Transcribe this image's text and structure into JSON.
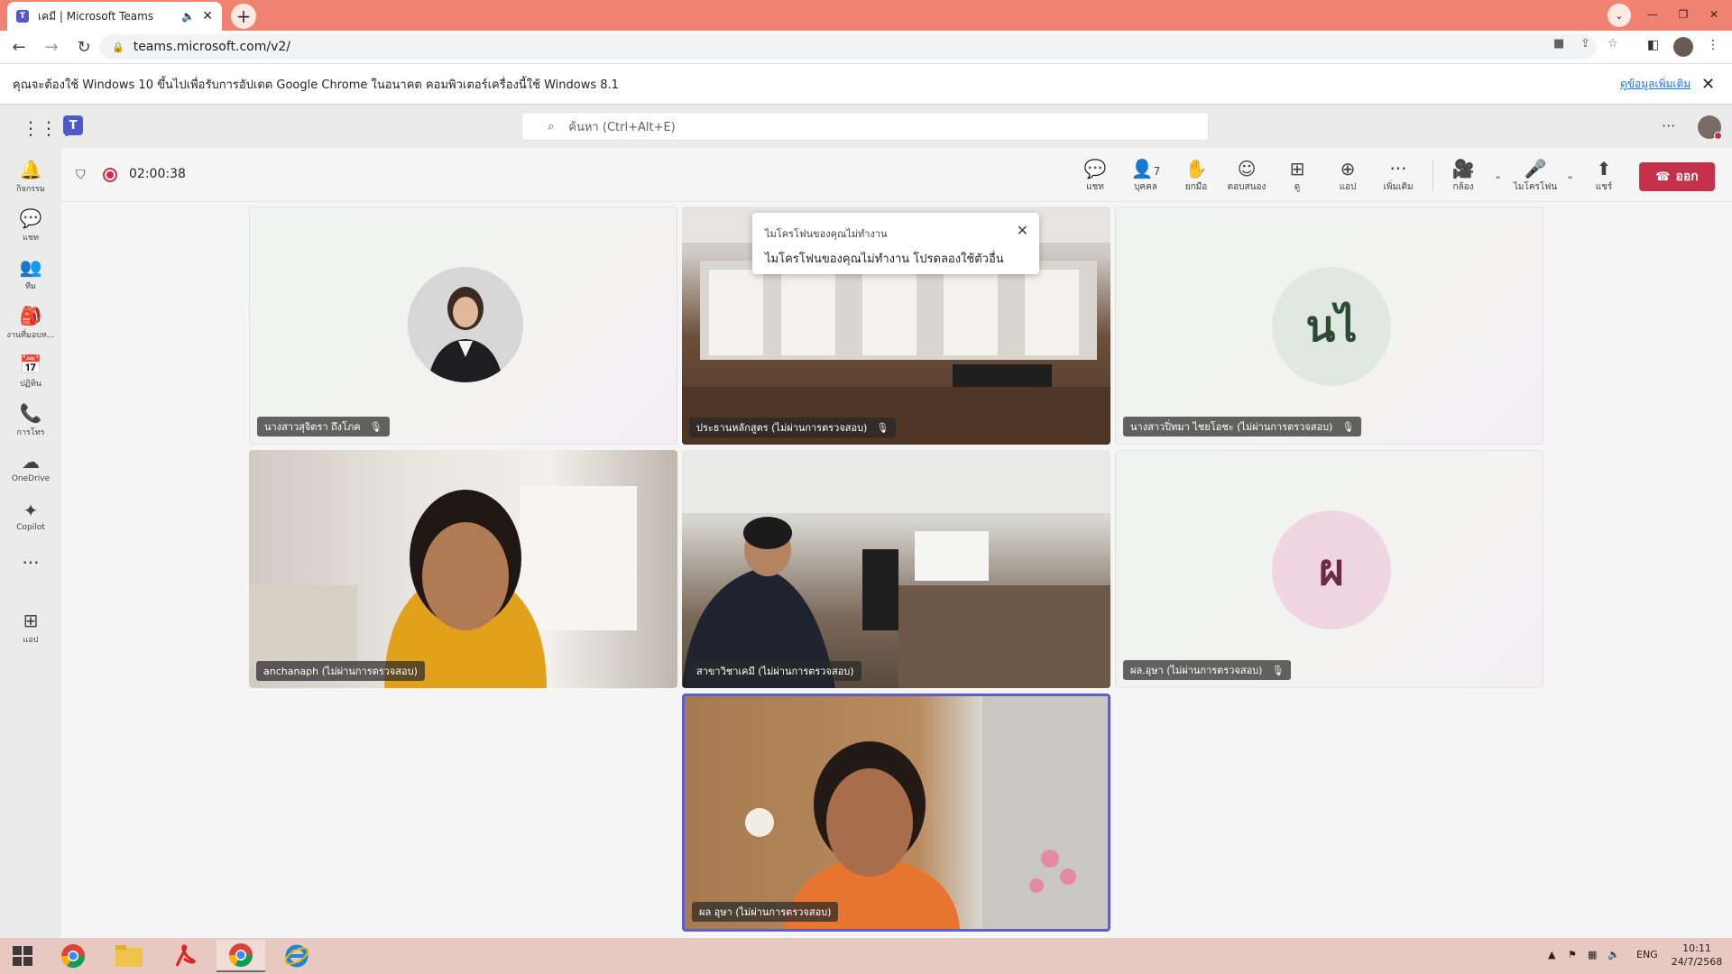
{
  "browser": {
    "tab_title": "เคมี | Microsoft Teams",
    "tab_favicon": "T",
    "sound_icon": "🔈",
    "tab_close": "✕",
    "new_tab": "+",
    "url": "teams.microsoft.com/v2/",
    "tab_search": "⌄",
    "win_min": "—",
    "win_restore": "❐",
    "win_close": "✕"
  },
  "infobar": {
    "message": "คุณจะต้องใช้ Windows 10 ขึ้นไปเพื่อรับการอัปเดต Google Chrome ในอนาคต คอมพิวเตอร์เครื่องนี้ใช้ Windows 8.1",
    "more_link": "ดูข้อมูลเพิ่มเติม",
    "close": "✕"
  },
  "teams": {
    "logo": "T",
    "search_placeholder": "ค้นหา (Ctrl+Alt+E)",
    "more": "···"
  },
  "rail": [
    {
      "name": "activity",
      "icon": "🔔",
      "label": "กิจกรรม"
    },
    {
      "name": "chat",
      "icon": "💬",
      "label": "แชท"
    },
    {
      "name": "teams",
      "icon": "👥",
      "label": "ทีม"
    },
    {
      "name": "assignments",
      "icon": "🎒",
      "label": "งานที่มอบห..."
    },
    {
      "name": "calendar",
      "icon": "📅",
      "label": "ปฏิทิน"
    },
    {
      "name": "calls",
      "icon": "📞",
      "label": "การโทร"
    },
    {
      "name": "onedrive",
      "icon": "☁",
      "label": "OneDrive"
    },
    {
      "name": "copilot",
      "icon": "✦",
      "label": "Copilot"
    },
    {
      "name": "more",
      "icon": "···",
      "label": ""
    },
    {
      "name": "apps",
      "icon": "⊞",
      "label": "แอป"
    }
  ],
  "meeting": {
    "timer": "02:00:38",
    "tools": {
      "chat": {
        "icon": "💬",
        "label": "แชท"
      },
      "people": {
        "icon": "👤",
        "label": "บุคคล",
        "count": "7"
      },
      "raise": {
        "icon": "✋",
        "label": "ยกมือ"
      },
      "react": {
        "icon": "☺",
        "label": "ตอบสนอง"
      },
      "view": {
        "icon": "⊞",
        "label": "ดู"
      },
      "apps": {
        "icon": "⊕",
        "label": "แอป"
      },
      "more": {
        "icon": "···",
        "label": "เพิ่มเติม"
      },
      "camera": {
        "icon": "🎥",
        "label": "กล้อง"
      },
      "mic": {
        "icon": "🎤",
        "label": "ไมโครโฟน"
      },
      "share": {
        "icon": "⬆",
        "label": "แชร์"
      }
    },
    "chevron": "⌄",
    "leave_label": "ออก",
    "leave_icon": "☎"
  },
  "participants": [
    {
      "name": "นางสาวสุจิตรา ถึงโภค",
      "type": "photo",
      "muted": true
    },
    {
      "name": "ประธานหลักสูตร (ไม่ผ่านการตรวจสอบ)",
      "type": "video",
      "muted": true
    },
    {
      "name": "นางสาวปิ่ทมา ไชยโอชะ (ไม่ผ่านการตรวจสอบ)",
      "type": "initials",
      "initials": "นไ",
      "muted": true,
      "color": "#dfe9e1",
      "text_color": "#2d4a35"
    },
    {
      "name": "anchanaph (ไม่ผ่านการตรวจสอบ)",
      "type": "video",
      "muted": false
    },
    {
      "name": "สาขาวิชาเคมี (ไม่ผ่านการตรวจสอบ)",
      "type": "video",
      "muted": false
    },
    {
      "name": "ผล.อุษา (ไม่ผ่านการตรวจสอบ)",
      "type": "initials",
      "initials": "ผ",
      "muted": true,
      "color": "#f0d6e0",
      "text_color": "#6a2b45"
    },
    {
      "name": "ผล อุษา (ไม่ผ่านการตรวจสอบ)",
      "type": "video",
      "muted": false,
      "speaking": true
    }
  ],
  "mic_muted_icon": "🎙",
  "toast": {
    "title": "ไมโครโฟนของคุณไม่ทำงาน",
    "body": "ไมโครโฟนของคุณไม่ทำงาน โปรดลองใช้ตัวอื่น",
    "close": "✕"
  },
  "taskbar": {
    "start": "⊞",
    "apps": [
      "chrome",
      "file-explorer",
      "acrobat",
      "chrome-active",
      "internet-explorer"
    ],
    "lang": "ENG",
    "time": "10:11",
    "date": "24/7/2568"
  }
}
